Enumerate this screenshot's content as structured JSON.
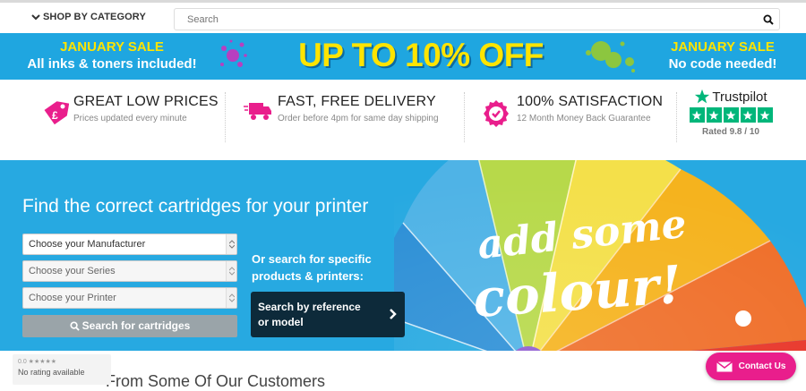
{
  "topbar": {
    "category_label": "SHOP BY CATEGORY",
    "search_placeholder": "Search"
  },
  "sale_banner": {
    "left_title": "JANUARY SALE",
    "left_sub": "All inks & toners included!",
    "headline": "UP TO 10% OFF",
    "right_title": "JANUARY SALE",
    "right_sub": "No code needed!",
    "colors": {
      "bg": "#1fa6e0",
      "yellow": "#ffe400"
    }
  },
  "usp": [
    {
      "icon": "price-tag-icon",
      "title": "GREAT LOW PRICES",
      "sub": "Prices updated every minute"
    },
    {
      "icon": "delivery-truck-icon",
      "title": "FAST, FREE DELIVERY",
      "sub": "Order before 4pm for same day shipping"
    },
    {
      "icon": "satisfaction-badge-icon",
      "title": "100% SATISFACTION",
      "sub": "12 Month Money Back Guarantee"
    }
  ],
  "trustpilot": {
    "name": "Trustpilot",
    "rated": "Rated 9.8 / 10",
    "stars": 5
  },
  "finder": {
    "headline": "Find the correct cartridges for your printer",
    "manufacturer": "Choose your Manufacturer",
    "series": "Choose your Series",
    "printer": "Choose your Printer",
    "search_button": "Search for cartridges",
    "or_search": "Or search for specific products & printers:",
    "ref_button": "Search by reference or model",
    "slogan_line1": "add some",
    "slogan_line2": "colour!"
  },
  "bottom": {
    "customers_heading": "From Some Of Our Customers",
    "rating_score": "0.0 ★★★★★",
    "rating_text": "No rating available",
    "contact_label": "Contact Us"
  }
}
